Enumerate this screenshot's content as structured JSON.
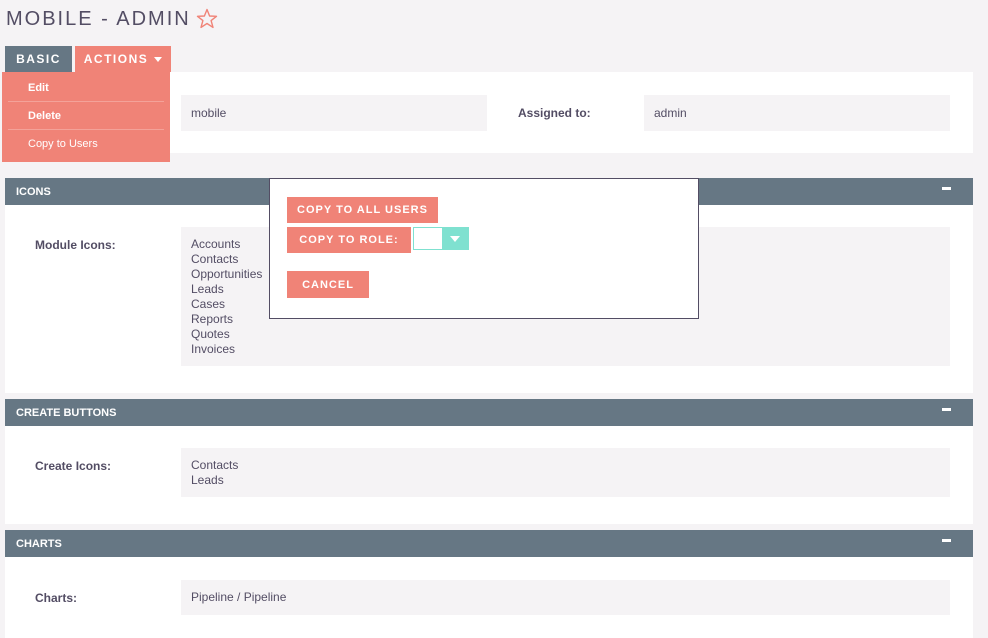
{
  "page": {
    "title": "MOBILE - ADMIN"
  },
  "tabs": {
    "basic": "BASIC",
    "actions": "ACTIONS"
  },
  "actions_menu": [
    {
      "label": "Edit"
    },
    {
      "label": "Delete"
    },
    {
      "label": "Copy to Users"
    }
  ],
  "basic": {
    "name_value": "mobile",
    "assigned_label": "Assigned to:",
    "assigned_value": "admin"
  },
  "icons_panel": {
    "title": "ICONS",
    "label": "Module Icons:",
    "items": [
      "Accounts",
      "Contacts",
      "Opportunities",
      "Leads",
      "Cases",
      "Reports",
      "Quotes",
      "Invoices"
    ]
  },
  "create_panel": {
    "title": "CREATE BUTTONS",
    "label": "Create Icons:",
    "items": [
      "Contacts",
      "Leads"
    ]
  },
  "charts_panel": {
    "title": "CHARTS",
    "label": "Charts:",
    "value": "Pipeline / Pipeline"
  },
  "modal": {
    "copy_all": "COPY TO ALL USERS",
    "copy_role": "COPY TO ROLE:",
    "cancel": "CANCEL"
  },
  "colors": {
    "accent": "#f08377",
    "header": "#667784",
    "text": "#534d64",
    "select": "#7fe1d0"
  }
}
